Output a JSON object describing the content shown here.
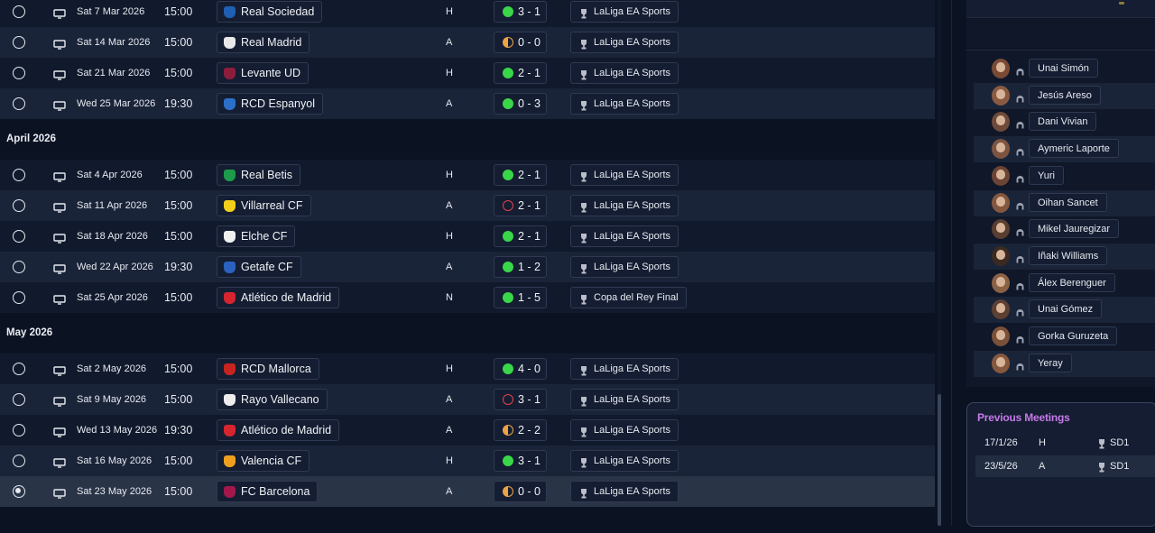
{
  "colors": {
    "win": "#3ad64a",
    "draw": "#f0a343",
    "loss": "#e4434a",
    "meetings_title": "#c57ae8"
  },
  "fixtures": {
    "rows": [
      {
        "date": "Sat 7 Mar 2026",
        "time": "15:00",
        "team": "Real Sociedad",
        "crest_color": "#1f5fb4",
        "venue": "H",
        "result": "win",
        "score": "3 - 1",
        "competition": "LaLiga EA Sports"
      },
      {
        "date": "Sat 14 Mar 2026",
        "time": "15:00",
        "team": "Real Madrid",
        "crest_color": "#e8e8e8",
        "venue": "A",
        "result": "draw",
        "score": "0 - 0",
        "competition": "LaLiga EA Sports"
      },
      {
        "date": "Sat 21 Mar 2026",
        "time": "15:00",
        "team": "Levante UD",
        "crest_color": "#8e1d3c",
        "venue": "H",
        "result": "win",
        "score": "2 - 1",
        "competition": "LaLiga EA Sports"
      },
      {
        "date": "Wed 25 Mar 2026",
        "time": "19:30",
        "team": "RCD Espanyol",
        "crest_color": "#2c6fc9",
        "venue": "A",
        "result": "win",
        "score": "0 - 3",
        "competition": "LaLiga EA Sports"
      },
      {
        "month": "April 2026"
      },
      {
        "date": "Sat 4 Apr 2026",
        "time": "15:00",
        "team": "Real Betis",
        "crest_color": "#1d9b4a",
        "venue": "H",
        "result": "win",
        "score": "2 - 1",
        "competition": "LaLiga EA Sports"
      },
      {
        "date": "Sat 11 Apr 2026",
        "time": "15:00",
        "team": "Villarreal CF",
        "crest_color": "#f2cf1b",
        "venue": "A",
        "result": "loss",
        "score": "2 - 1",
        "competition": "LaLiga EA Sports"
      },
      {
        "date": "Sat 18 Apr 2026",
        "time": "15:00",
        "team": "Elche CF",
        "crest_color": "#f0f0f0",
        "venue": "H",
        "result": "win",
        "score": "2 - 1",
        "competition": "LaLiga EA Sports"
      },
      {
        "date": "Wed 22 Apr 2026",
        "time": "19:30",
        "team": "Getafe CF",
        "crest_color": "#2a62c0",
        "venue": "A",
        "result": "win",
        "score": "1 - 2",
        "competition": "LaLiga EA Sports"
      },
      {
        "date": "Sat 25 Apr 2026",
        "time": "15:00",
        "team": "Atlético de Madrid",
        "crest_color": "#d6252f",
        "venue": "N",
        "result": "win",
        "score": "1 - 5",
        "competition": "Copa del Rey Final"
      },
      {
        "month": "May 2026"
      },
      {
        "date": "Sat 2 May 2026",
        "time": "15:00",
        "team": "RCD Mallorca",
        "crest_color": "#c8241f",
        "venue": "H",
        "result": "win",
        "score": "4 - 0",
        "competition": "LaLiga EA Sports"
      },
      {
        "date": "Sat 9 May 2026",
        "time": "15:00",
        "team": "Rayo Vallecano",
        "crest_color": "#ececec",
        "venue": "A",
        "result": "loss",
        "score": "3 - 1",
        "competition": "LaLiga EA Sports"
      },
      {
        "date": "Wed 13 May 2026",
        "time": "19:30",
        "team": "Atlético de Madrid",
        "crest_color": "#d6252f",
        "venue": "A",
        "result": "draw",
        "score": "2 - 2",
        "competition": "LaLiga EA Sports"
      },
      {
        "date": "Sat 16 May 2026",
        "time": "15:00",
        "team": "Valencia CF",
        "crest_color": "#f0a020",
        "venue": "H",
        "result": "win",
        "score": "3 - 1",
        "competition": "LaLiga EA Sports"
      },
      {
        "date": "Sat 23 May 2026",
        "time": "15:00",
        "team": "FC Barcelona",
        "crest_color": "#a4174d",
        "venue": "A",
        "result": "draw",
        "score": "0 - 0",
        "competition": "LaLiga EA Sports",
        "selected": true
      }
    ]
  },
  "squad": {
    "players": [
      {
        "name": "Unai Simón",
        "skin": "#7a4a35"
      },
      {
        "name": "Jesús Areso",
        "skin": "#8a5a40"
      },
      {
        "name": "Dani Vivian",
        "skin": "#6e4a3a"
      },
      {
        "name": "Aymeric Laporte",
        "skin": "#7d5441"
      },
      {
        "name": "Yuri",
        "skin": "#6b4434"
      },
      {
        "name": "Oihan Sancet",
        "skin": "#83573f"
      },
      {
        "name": "Mikel Jauregizar",
        "skin": "#5a3e30"
      },
      {
        "name": "Iñaki Williams",
        "skin": "#3b2a22"
      },
      {
        "name": "Álex Berenguer",
        "skin": "#8b6146"
      },
      {
        "name": "Unai Gómez",
        "skin": "#5e4033"
      },
      {
        "name": "Gorka Guruzeta",
        "skin": "#7a5038"
      },
      {
        "name": "Yeray",
        "skin": "#86593f"
      }
    ]
  },
  "previous_meetings": {
    "title": "Previous Meetings",
    "rows": [
      {
        "date": "17/1/26",
        "venue": "H",
        "competition": "SD1"
      },
      {
        "date": "23/5/26",
        "venue": "A",
        "competition": "SD1"
      }
    ]
  }
}
